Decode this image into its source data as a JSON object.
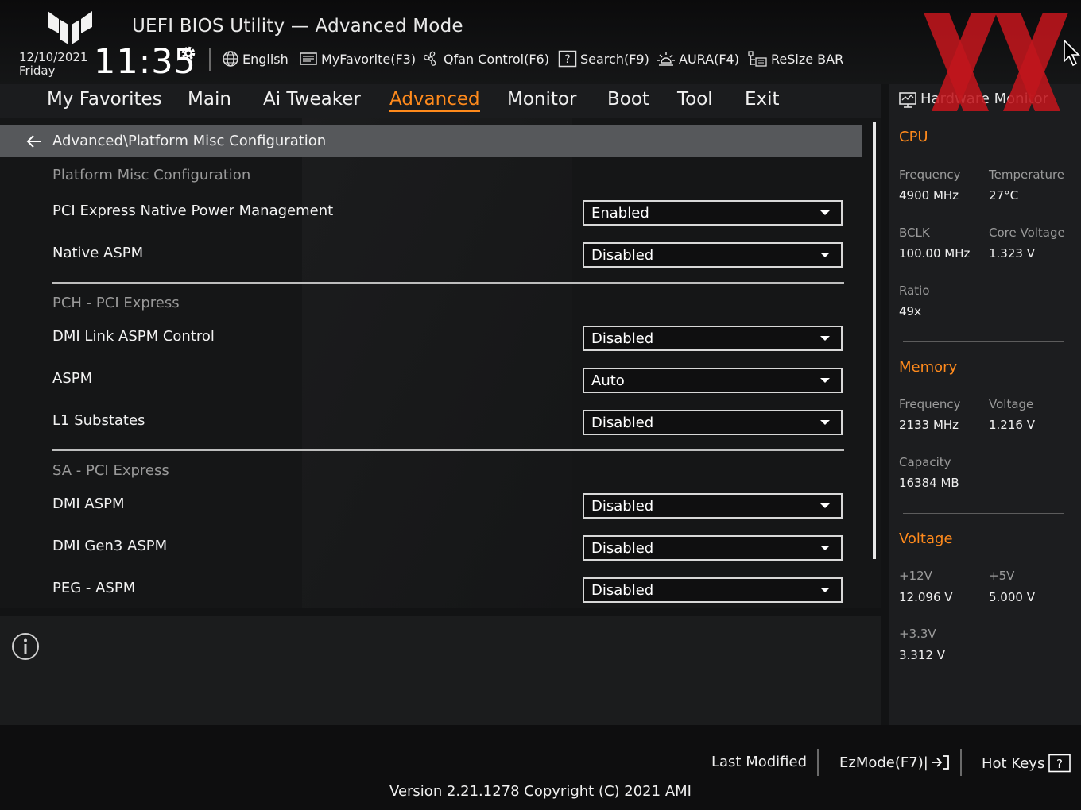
{
  "header": {
    "title": "UEFI BIOS Utility — Advanced Mode",
    "date": "12/10/2021",
    "weekday": "Friday",
    "time": "11:35",
    "toolbar": {
      "language": "English",
      "myfavorite": "MyFavorite(F3)",
      "qfan": "Qfan Control(F6)",
      "search": "Search(F9)",
      "aura": "AURA(F4)",
      "resize_bar": "ReSize BAR"
    }
  },
  "nav": {
    "tabs": [
      "My Favorites",
      "Main",
      "Ai Tweaker",
      "Advanced",
      "Monitor",
      "Boot",
      "Tool",
      "Exit"
    ],
    "active": "Advanced"
  },
  "main": {
    "breadcrumb": "Advanced\\Platform Misc Configuration",
    "sections": [
      {
        "title": "Platform Misc Configuration",
        "items": [
          {
            "label": "PCI Express Native Power Management",
            "value": "Enabled"
          },
          {
            "label": "Native ASPM",
            "value": "Disabled"
          }
        ]
      },
      {
        "title": "PCH - PCI Express",
        "items": [
          {
            "label": "DMI Link ASPM Control",
            "value": "Disabled"
          },
          {
            "label": "ASPM",
            "value": "Auto"
          },
          {
            "label": "L1 Substates",
            "value": "Disabled"
          }
        ]
      },
      {
        "title": "SA - PCI Express",
        "items": [
          {
            "label": "DMI ASPM",
            "value": "Disabled"
          },
          {
            "label": "DMI Gen3 ASPM",
            "value": "Disabled"
          },
          {
            "label": "PEG - ASPM",
            "value": "Disabled"
          }
        ]
      }
    ]
  },
  "hw_monitor": {
    "title": "Hardware Monitor",
    "cpu": {
      "heading": "CPU",
      "frequency_label": "Frequency",
      "frequency": "4900 MHz",
      "temperature_label": "Temperature",
      "temperature": "27°C",
      "bclk_label": "BCLK",
      "bclk": "100.00 MHz",
      "core_voltage_label": "Core Voltage",
      "core_voltage": "1.323 V",
      "ratio_label": "Ratio",
      "ratio": "49x"
    },
    "memory": {
      "heading": "Memory",
      "frequency_label": "Frequency",
      "frequency": "2133 MHz",
      "voltage_label": "Voltage",
      "voltage": "1.216 V",
      "capacity_label": "Capacity",
      "capacity": "16384 MB"
    },
    "voltage": {
      "heading": "Voltage",
      "v12_label": "+12V",
      "v12": "12.096 V",
      "v5_label": "+5V",
      "v5": "5.000 V",
      "v33_label": "+3.3V",
      "v33": "3.312 V"
    }
  },
  "footer": {
    "last_modified": "Last Modified",
    "ezmode": "EzMode(F7)|",
    "hot_keys": "Hot Keys",
    "version": "Version 2.21.1278 Copyright (C) 2021 AMI"
  },
  "colors": {
    "accent": "#ff8a1c",
    "background": "#121314",
    "breadcrumb_bar": "#56585b",
    "watermark": "#c0161c"
  }
}
